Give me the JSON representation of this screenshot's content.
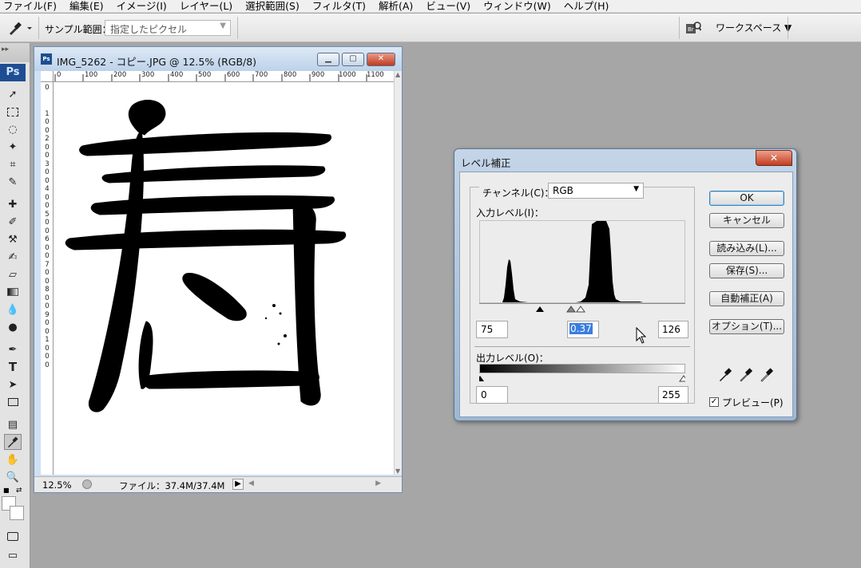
{
  "menubar": {
    "items": [
      "ファイル(F)",
      "編集(E)",
      "イメージ(I)",
      "レイヤー(L)",
      "選択範囲(S)",
      "フィルタ(T)",
      "解析(A)",
      "ビュー(V)",
      "ウィンドウ(W)",
      "ヘルプ(H)"
    ]
  },
  "options": {
    "sample_label": "サンプル範囲：",
    "sample_value": "指定したピクセル",
    "workspace_label": "ワークスペース"
  },
  "toolbar": {
    "logo": "Ps",
    "grip": "▸▸"
  },
  "document": {
    "title": "IMG_5262 - コピー.JPG @ 12.5% (RGB/8)",
    "ps_icon_text": "Ps",
    "zoom": "12.5%",
    "file_info": "ファイル：37.4M/37.4M",
    "ruler_h": [
      "0",
      "100",
      "200",
      "300",
      "400",
      "500",
      "600",
      "700",
      "800",
      "900",
      "1000",
      "1100"
    ],
    "ruler_v": [
      "0",
      "1",
      "0",
      "0",
      "2",
      "0",
      "0",
      "3",
      "0",
      "0",
      "4",
      "0",
      "0",
      "5",
      "0",
      "0",
      "6",
      "0",
      "0",
      "7",
      "0",
      "0",
      "8",
      "0",
      "0",
      "9",
      "0",
      "0",
      "1",
      "0",
      "0",
      "0"
    ]
  },
  "levels": {
    "title": "レベル補正",
    "channel_label": "チャンネル(C)：",
    "channel_value": "RGB",
    "input_label": "入力レベル(I)：",
    "input_black": "75",
    "input_gamma": "0.37",
    "input_white": "126",
    "output_label": "出力レベル(O)：",
    "output_black": "0",
    "output_white": "255",
    "buttons": {
      "ok": "OK",
      "cancel": "キャンセル",
      "load": "読み込み(L)...",
      "save": "保存(S)...",
      "auto": "自動補正(A)",
      "options": "オプション(T)..."
    },
    "preview_label": "プレビュー(P)",
    "preview_checked": true
  }
}
